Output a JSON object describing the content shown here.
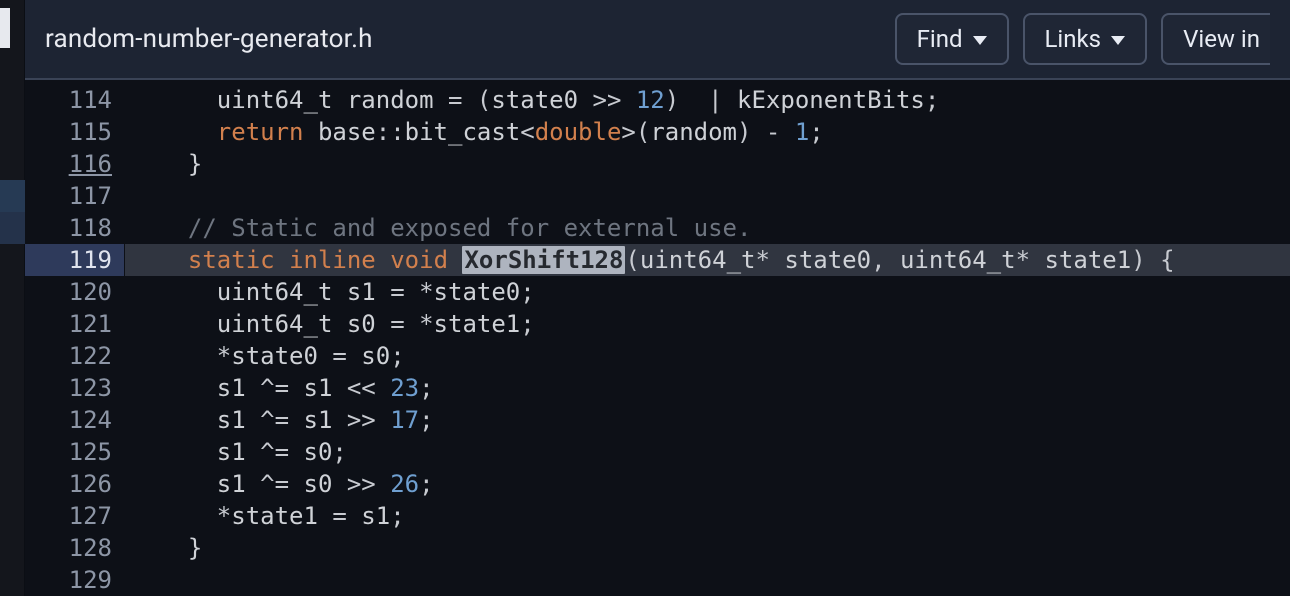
{
  "filename": "random-number-generator.h",
  "buttons": {
    "find": "Find",
    "links": "Links",
    "view": "View in"
  },
  "line_numbers": [
    "114",
    "115",
    "116",
    "117",
    "118",
    "119",
    "120",
    "121",
    "122",
    "123",
    "124",
    "125",
    "126",
    "127",
    "128",
    "129"
  ],
  "highlighted_line": "119",
  "underlined_line": "116",
  "selected_symbol": "XorShift128",
  "code": {
    "114": {
      "indent": "    ",
      "tokens": [
        [
          "t",
          "uint64_t"
        ],
        [
          "p",
          " random "
        ],
        [
          "op",
          "="
        ],
        [
          "p",
          " "
        ],
        [
          "op",
          "("
        ],
        [
          "id",
          "state0"
        ],
        [
          "p",
          " "
        ],
        [
          "op",
          ">>"
        ],
        [
          "p",
          " "
        ],
        [
          "n",
          "12"
        ],
        [
          "op",
          ")"
        ],
        [
          "p",
          "  "
        ],
        [
          "op",
          "|"
        ],
        [
          "p",
          " kExponentBits"
        ],
        [
          "op",
          ";"
        ]
      ]
    },
    "115": {
      "indent": "    ",
      "tokens": [
        [
          "k",
          "return"
        ],
        [
          "p",
          " base"
        ],
        [
          "op",
          "::"
        ],
        [
          "id",
          "bit_cast"
        ],
        [
          "op",
          "<"
        ],
        [
          "k",
          "double"
        ],
        [
          "op",
          ">("
        ],
        [
          "id",
          "random"
        ],
        [
          "op",
          ")"
        ],
        [
          "p",
          " "
        ],
        [
          "op",
          "-"
        ],
        [
          "p",
          " "
        ],
        [
          "n",
          "1"
        ],
        [
          "op",
          ";"
        ]
      ]
    },
    "116": {
      "indent": "  ",
      "tokens": [
        [
          "p",
          "}"
        ]
      ]
    },
    "117": {
      "indent": "",
      "tokens": []
    },
    "118": {
      "indent": "  ",
      "tokens": [
        [
          "c",
          "// Static and exposed for external use."
        ]
      ]
    },
    "119": {
      "indent": "  ",
      "tokens": [
        [
          "k",
          "static"
        ],
        [
          "p",
          " "
        ],
        [
          "k",
          "inline"
        ],
        [
          "p",
          " "
        ],
        [
          "k",
          "void"
        ],
        [
          "p",
          " "
        ],
        [
          "sel",
          "XorShift128"
        ],
        [
          "op",
          "("
        ],
        [
          "t",
          "uint64_t"
        ],
        [
          "op",
          "*"
        ],
        [
          "p",
          " state0"
        ],
        [
          "op",
          ","
        ],
        [
          "p",
          " "
        ],
        [
          "t",
          "uint64_t"
        ],
        [
          "op",
          "*"
        ],
        [
          "p",
          " state1"
        ],
        [
          "op",
          ")"
        ],
        [
          "p",
          " "
        ],
        [
          "op",
          "{"
        ]
      ]
    },
    "120": {
      "indent": "    ",
      "tokens": [
        [
          "t",
          "uint64_t"
        ],
        [
          "p",
          " s1 "
        ],
        [
          "op",
          "="
        ],
        [
          "p",
          " "
        ],
        [
          "op",
          "*"
        ],
        [
          "id",
          "state0"
        ],
        [
          "op",
          ";"
        ]
      ]
    },
    "121": {
      "indent": "    ",
      "tokens": [
        [
          "t",
          "uint64_t"
        ],
        [
          "p",
          " s0 "
        ],
        [
          "op",
          "="
        ],
        [
          "p",
          " "
        ],
        [
          "op",
          "*"
        ],
        [
          "id",
          "state1"
        ],
        [
          "op",
          ";"
        ]
      ]
    },
    "122": {
      "indent": "    ",
      "tokens": [
        [
          "op",
          "*"
        ],
        [
          "id",
          "state0"
        ],
        [
          "p",
          " "
        ],
        [
          "op",
          "="
        ],
        [
          "p",
          " s0"
        ],
        [
          "op",
          ";"
        ]
      ]
    },
    "123": {
      "indent": "    ",
      "tokens": [
        [
          "id",
          "s1"
        ],
        [
          "p",
          " "
        ],
        [
          "op",
          "^="
        ],
        [
          "p",
          " s1 "
        ],
        [
          "op",
          "<<"
        ],
        [
          "p",
          " "
        ],
        [
          "n",
          "23"
        ],
        [
          "op",
          ";"
        ]
      ]
    },
    "124": {
      "indent": "    ",
      "tokens": [
        [
          "id",
          "s1"
        ],
        [
          "p",
          " "
        ],
        [
          "op",
          "^="
        ],
        [
          "p",
          " s1 "
        ],
        [
          "op",
          ">>"
        ],
        [
          "p",
          " "
        ],
        [
          "n",
          "17"
        ],
        [
          "op",
          ";"
        ]
      ]
    },
    "125": {
      "indent": "    ",
      "tokens": [
        [
          "id",
          "s1"
        ],
        [
          "p",
          " "
        ],
        [
          "op",
          "^="
        ],
        [
          "p",
          " s0"
        ],
        [
          "op",
          ";"
        ]
      ]
    },
    "126": {
      "indent": "    ",
      "tokens": [
        [
          "id",
          "s1"
        ],
        [
          "p",
          " "
        ],
        [
          "op",
          "^="
        ],
        [
          "p",
          " s0 "
        ],
        [
          "op",
          ">>"
        ],
        [
          "p",
          " "
        ],
        [
          "n",
          "26"
        ],
        [
          "op",
          ";"
        ]
      ]
    },
    "127": {
      "indent": "    ",
      "tokens": [
        [
          "op",
          "*"
        ],
        [
          "id",
          "state1"
        ],
        [
          "p",
          " "
        ],
        [
          "op",
          "="
        ],
        [
          "p",
          " s1"
        ],
        [
          "op",
          ";"
        ]
      ]
    },
    "128": {
      "indent": "  ",
      "tokens": [
        [
          "p",
          "}"
        ]
      ]
    },
    "129": {
      "indent": "",
      "tokens": []
    }
  }
}
